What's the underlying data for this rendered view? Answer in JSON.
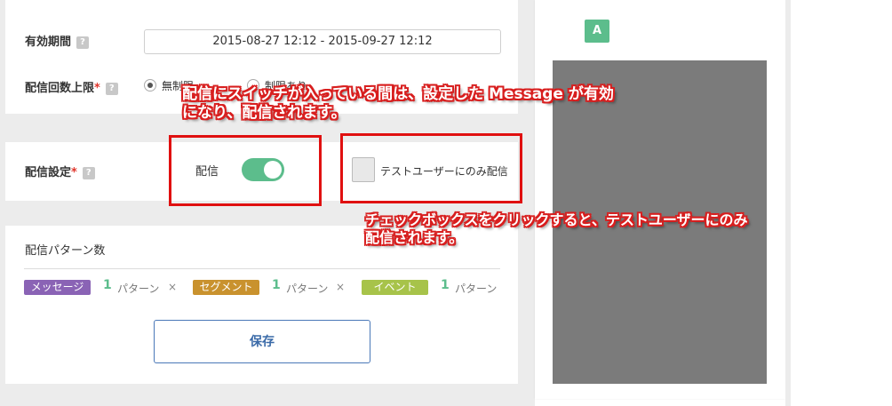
{
  "validity": {
    "label": "有効期間",
    "help": "?",
    "value": "2015-08-27 12:12  -  2015-09-27 12:12"
  },
  "delivery_limit": {
    "label": "配信回数上限",
    "required_mark": "*",
    "help": "?",
    "options": [
      {
        "label": "無制限",
        "selected": true
      },
      {
        "label": "制限あり",
        "selected": false
      }
    ]
  },
  "delivery_setting": {
    "label": "配信設定",
    "required_mark": "*",
    "help": "?",
    "toggle_label": "配信",
    "toggle_on": true,
    "test_user_checkbox_label": "テストユーザーにのみ配信",
    "test_user_checked": false
  },
  "patterns": {
    "title": "配信パターン数",
    "unit": "パターン",
    "remove_icon": "×",
    "items": [
      {
        "tag": "メッセージ",
        "count": "1",
        "color": "#8a63b5"
      },
      {
        "tag": "セグメント",
        "count": "1",
        "color": "#c9922e"
      },
      {
        "tag": "イベント",
        "count": "1",
        "color": "#a7c34a"
      }
    ]
  },
  "save_label": "保存",
  "preview": {
    "badge": "A"
  },
  "annotations": {
    "toggle_note_line1": "配信にスイッチが入っている間は、設定した Message が有効",
    "toggle_note_line2": "になり、配信されます。",
    "checkbox_note_line1": "チェックボックスをクリックすると、テストユーザーにのみ",
    "checkbox_note_line2": "配信されます。"
  },
  "colors": {
    "accent_green": "#5cbd8c",
    "annotation_red": "#e01010",
    "save_blue": "#3a6aa8"
  }
}
